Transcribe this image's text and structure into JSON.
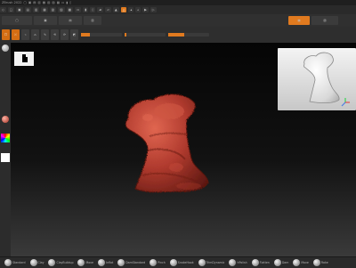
{
  "window": {
    "title_bits": [
      "ZBrush 2022",
      "▢",
      "▣",
      "▤",
      "▥",
      "▦",
      "▧",
      "▨",
      "▩",
      "▭",
      "▮",
      "▯"
    ]
  },
  "menubar": {
    "items": [
      "◇",
      "▢",
      "▣",
      "▤",
      "▥",
      "▦",
      "▧",
      "▨",
      "▩",
      "▭",
      "▮",
      "▯",
      "▰",
      "▱",
      "▲",
      "△",
      "▴",
      "▵",
      "▶",
      "▷"
    ]
  },
  "toolbar": {
    "items": [
      "▢",
      "▣",
      "▤",
      "▥",
      "▦",
      "▧"
    ]
  },
  "toolbar2": {
    "buttons": [
      "☐",
      "⤫",
      "⌁",
      "⌂",
      "✎",
      "⟲",
      "⟳",
      "◩"
    ],
    "sliders": [
      {
        "label": "",
        "fill": 0.22
      },
      {
        "label": "",
        "fill": 0.05
      },
      {
        "label": "",
        "fill": 0.4
      }
    ]
  },
  "colors": {
    "accent": "#e07a1f",
    "model": "#b03a2e",
    "model_dark": "#6c1e15",
    "model_light": "#d35c45",
    "navigator_bg": "#f0f0f0"
  },
  "left_tray": {
    "icons": [
      "sphere-brush-icon",
      "material-icon",
      "color-picker-icon"
    ]
  },
  "bottom_shelf": {
    "items": [
      "Standard",
      "Clay",
      "ClayBuildup",
      "Move",
      "Inflat",
      "DamStandard",
      "Pinch",
      "SnakeHook",
      "TrimDynamic",
      "hPolish",
      "Flatten",
      "Dam",
      "Move",
      "Rake"
    ]
  }
}
